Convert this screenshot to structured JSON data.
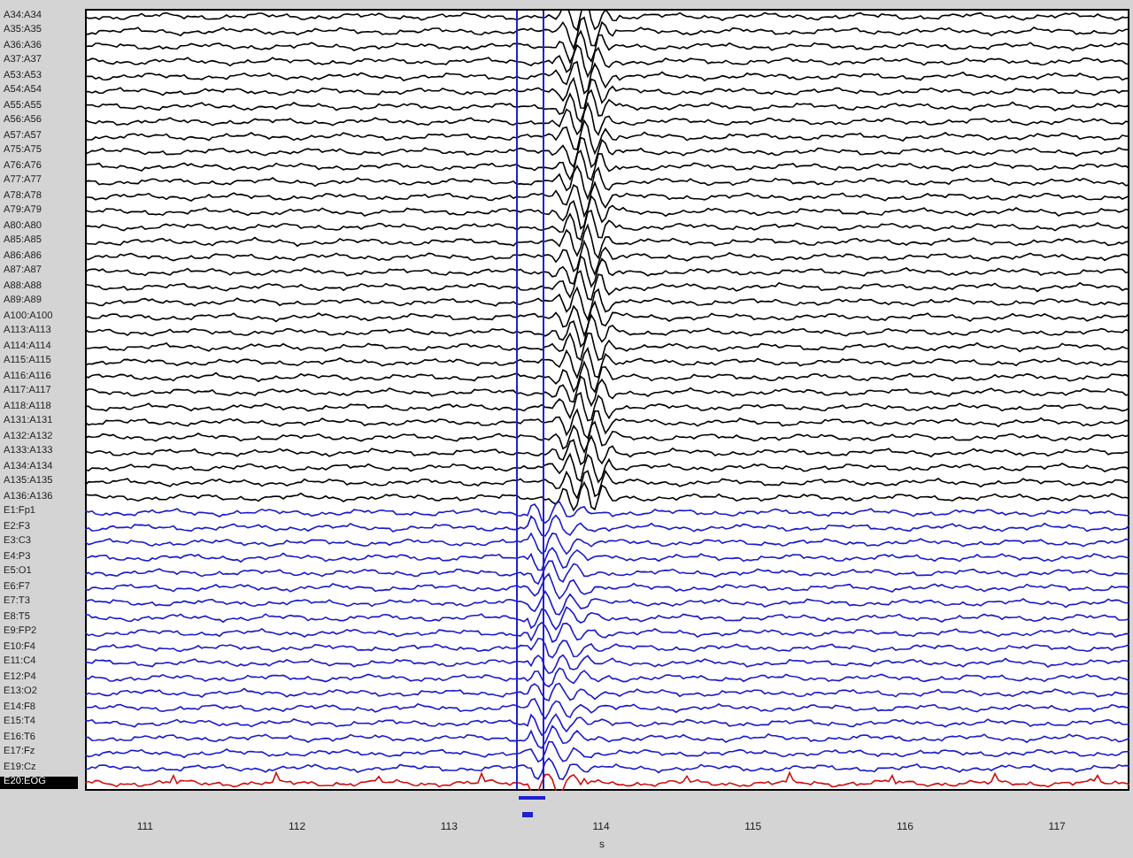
{
  "channels": [
    {
      "label": "A34:A34",
      "color": "#000000",
      "selected": false
    },
    {
      "label": "A35:A35",
      "color": "#000000",
      "selected": false
    },
    {
      "label": "A36:A36",
      "color": "#000000",
      "selected": false
    },
    {
      "label": "A37:A37",
      "color": "#000000",
      "selected": false
    },
    {
      "label": "A53:A53",
      "color": "#000000",
      "selected": false
    },
    {
      "label": "A54:A54",
      "color": "#000000",
      "selected": false
    },
    {
      "label": "A55:A55",
      "color": "#000000",
      "selected": false
    },
    {
      "label": "A56:A56",
      "color": "#000000",
      "selected": false
    },
    {
      "label": "A57:A57",
      "color": "#000000",
      "selected": false
    },
    {
      "label": "A75:A75",
      "color": "#000000",
      "selected": false
    },
    {
      "label": "A76:A76",
      "color": "#000000",
      "selected": false
    },
    {
      "label": "A77:A77",
      "color": "#000000",
      "selected": false
    },
    {
      "label": "A78:A78",
      "color": "#000000",
      "selected": false
    },
    {
      "label": "A79:A79",
      "color": "#000000",
      "selected": false
    },
    {
      "label": "A80:A80",
      "color": "#000000",
      "selected": false
    },
    {
      "label": "A85:A85",
      "color": "#000000",
      "selected": false
    },
    {
      "label": "A86:A86",
      "color": "#000000",
      "selected": false
    },
    {
      "label": "A87:A87",
      "color": "#000000",
      "selected": false
    },
    {
      "label": "A88:A88",
      "color": "#000000",
      "selected": false
    },
    {
      "label": "A89:A89",
      "color": "#000000",
      "selected": false
    },
    {
      "label": "A100:A100",
      "color": "#000000",
      "selected": false
    },
    {
      "label": "A113:A113",
      "color": "#000000",
      "selected": false
    },
    {
      "label": "A114:A114",
      "color": "#000000",
      "selected": false
    },
    {
      "label": "A115:A115",
      "color": "#000000",
      "selected": false
    },
    {
      "label": "A116:A116",
      "color": "#000000",
      "selected": false
    },
    {
      "label": "A117:A117",
      "color": "#000000",
      "selected": false
    },
    {
      "label": "A118:A118",
      "color": "#000000",
      "selected": false
    },
    {
      "label": "A131:A131",
      "color": "#000000",
      "selected": false
    },
    {
      "label": "A132:A132",
      "color": "#000000",
      "selected": false
    },
    {
      "label": "A133:A133",
      "color": "#000000",
      "selected": false
    },
    {
      "label": "A134:A134",
      "color": "#000000",
      "selected": false
    },
    {
      "label": "A135:A135",
      "color": "#000000",
      "selected": false
    },
    {
      "label": "A136:A136",
      "color": "#000000",
      "selected": false
    },
    {
      "label": "E1:Fp1",
      "color": "#1a1ac8",
      "selected": false
    },
    {
      "label": "E2:F3",
      "color": "#1a1ac8",
      "selected": false
    },
    {
      "label": "E3:C3",
      "color": "#1a1ac8",
      "selected": false
    },
    {
      "label": "E4:P3",
      "color": "#1a1ac8",
      "selected": false
    },
    {
      "label": "E5:O1",
      "color": "#1a1ac8",
      "selected": false
    },
    {
      "label": "E6:F7",
      "color": "#1a1ac8",
      "selected": false
    },
    {
      "label": "E7:T3",
      "color": "#1a1ac8",
      "selected": false
    },
    {
      "label": "E8:T5",
      "color": "#1a1ac8",
      "selected": false
    },
    {
      "label": "E9:FP2",
      "color": "#1a1ac8",
      "selected": false
    },
    {
      "label": "E10:F4",
      "color": "#1a1ac8",
      "selected": false
    },
    {
      "label": "E11:C4",
      "color": "#1a1ac8",
      "selected": false
    },
    {
      "label": "E12:P4",
      "color": "#1a1ac8",
      "selected": false
    },
    {
      "label": "E13:O2",
      "color": "#1a1ac8",
      "selected": false
    },
    {
      "label": "E14:F8",
      "color": "#1a1ac8",
      "selected": false
    },
    {
      "label": "E15:T4",
      "color": "#1a1ac8",
      "selected": false
    },
    {
      "label": "E16:T6",
      "color": "#1a1ac8",
      "selected": false
    },
    {
      "label": "E17:Fz",
      "color": "#1a1ac8",
      "selected": false
    },
    {
      "label": "E19:Cz",
      "color": "#1a1ac8",
      "selected": false
    },
    {
      "label": "E20:EOG",
      "color": "#cc1010",
      "selected": true
    }
  ],
  "time_axis": {
    "ticks": [
      "111",
      "112",
      "113",
      "114",
      "115",
      "116",
      "117"
    ],
    "unit": "s"
  }
}
